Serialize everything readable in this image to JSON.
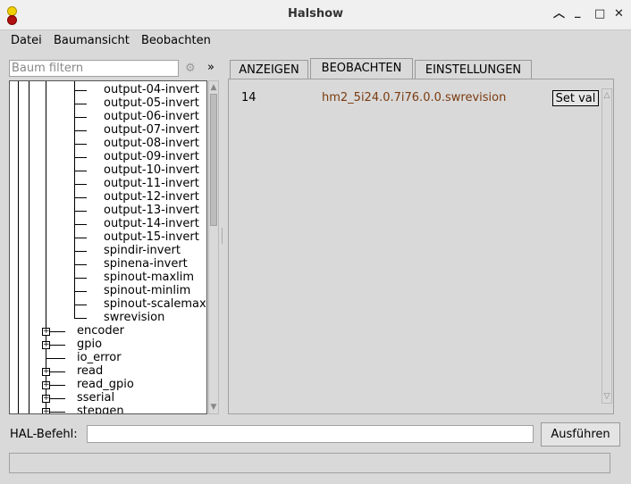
{
  "window": {
    "title": "Halshow"
  },
  "menu": [
    "Datei",
    "Baumansicht",
    "Beobachten"
  ],
  "filter": {
    "placeholder": "Baum filtern",
    "expand_label": "»"
  },
  "tree": {
    "leaf_items": [
      "output-04-invert",
      "output-05-invert",
      "output-06-invert",
      "output-07-invert",
      "output-08-invert",
      "output-09-invert",
      "output-10-invert",
      "output-11-invert",
      "output-12-invert",
      "output-13-invert",
      "output-14-invert",
      "output-15-invert",
      "spindir-invert",
      "spinena-invert",
      "spinout-maxlim",
      "spinout-minlim",
      "spinout-scalemax",
      "swrevision"
    ],
    "group_items": [
      {
        "label": "encoder",
        "expandable": true
      },
      {
        "label": "gpio",
        "expandable": true
      },
      {
        "label": "io_error",
        "expandable": false
      },
      {
        "label": "read",
        "expandable": true
      },
      {
        "label": "read_gpio",
        "expandable": true
      },
      {
        "label": "sserial",
        "expandable": true
      },
      {
        "label": "stepgen",
        "expandable": true
      }
    ]
  },
  "tabs": [
    {
      "label": "ANZEIGEN",
      "active": false
    },
    {
      "label": "BEOBACHTEN",
      "active": true
    },
    {
      "label": "EINSTELLUNGEN",
      "active": false
    }
  ],
  "watch": {
    "value": "14",
    "signal": "hm2_5i24.0.7i76.0.0.swrevision",
    "set_label": "Set val",
    "signal_color": "#7a3b10"
  },
  "command": {
    "label": "HAL-Befehl:",
    "value": "",
    "button": "Ausführen"
  },
  "status": ""
}
